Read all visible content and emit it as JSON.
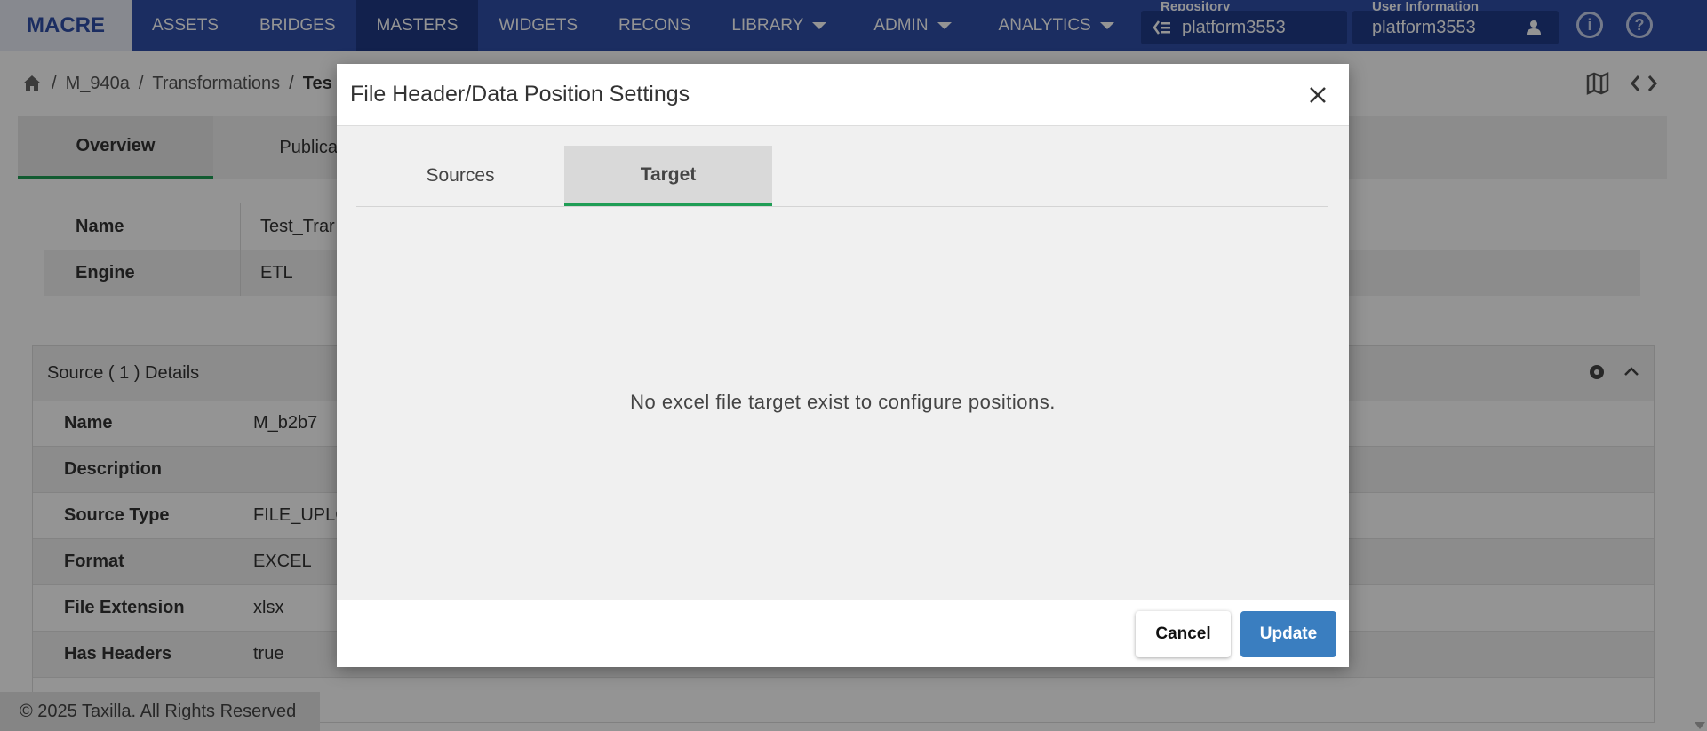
{
  "nav": {
    "brand": "MACRE",
    "items": [
      {
        "label": "ASSETS"
      },
      {
        "label": "BRIDGES"
      },
      {
        "label": "MASTERS"
      },
      {
        "label": "WIDGETS"
      },
      {
        "label": "RECONS"
      },
      {
        "label": "LIBRARY"
      },
      {
        "label": "ADMIN"
      },
      {
        "label": "ANALYTICS"
      }
    ],
    "active": "MASTERS",
    "repository_label": "Repository",
    "repository_value": "platform3553",
    "user_label": "User Information",
    "user_value": "platform3553"
  },
  "breadcrumb": {
    "items": [
      "M_940a",
      "Transformations",
      "Tes"
    ]
  },
  "page_tabs": [
    "Overview",
    "Publicat"
  ],
  "overview": [
    {
      "key": "Name",
      "value": "Test_Trar"
    },
    {
      "key": "Engine",
      "value": "ETL"
    }
  ],
  "source_panel": {
    "title": "Source ( 1 ) Details",
    "rows": [
      {
        "key": "Name",
        "value": "M_b2b7"
      },
      {
        "key": "Description",
        "value": ""
      },
      {
        "key": "Source Type",
        "value": "FILE_UPLC"
      },
      {
        "key": "Format",
        "value": "EXCEL"
      },
      {
        "key": "File Extension",
        "value": "xlsx"
      },
      {
        "key": "Has Headers",
        "value": "true"
      }
    ]
  },
  "footer": {
    "text": "© 2025 Taxilla. All Rights Reserved"
  },
  "modal": {
    "title": "File Header/Data Position Settings",
    "tabs": [
      "Sources",
      "Target"
    ],
    "active_tab": "Target",
    "empty_message": "No excel file target exist to configure positions.",
    "cancel_label": "Cancel",
    "update_label": "Update"
  },
  "colors": {
    "nav": "#2f4ea8",
    "accent_green": "#1f9d55",
    "primary_button": "#3a7ec0"
  }
}
